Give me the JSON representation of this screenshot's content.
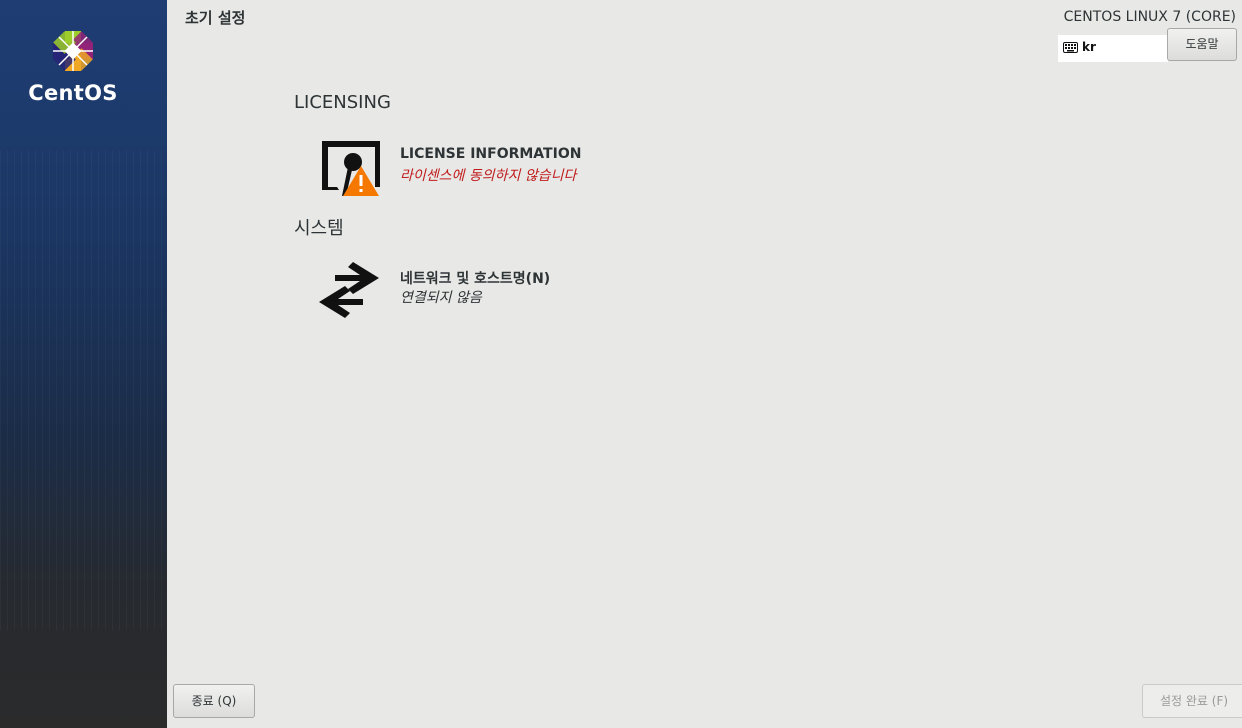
{
  "sidebar": {
    "logo_text": "CentOS"
  },
  "header": {
    "title": "초기 설정",
    "product": "CENTOS LINUX 7 (CORE)",
    "keyboard_layout": "kr",
    "help_label": "도움말"
  },
  "sections": [
    {
      "title": "LICENSING",
      "spokes": [
        {
          "title": "LICENSE INFORMATION",
          "status": "라이센스에 동의하지 않습니다",
          "icon": "license-warning-icon"
        }
      ]
    },
    {
      "title": "시스템",
      "spokes": [
        {
          "title": "네트워크 및 호스트명(N)",
          "status": "연결되지 않음",
          "icon": "network-arrows-icon"
        }
      ]
    }
  ],
  "footer": {
    "quit_label": "종료 (Q)",
    "finish_label": "설정 완료 (F)"
  },
  "colors": {
    "warning_text": "#c01c1c",
    "warning_icon": "#f57900",
    "sidebar_top": "#1f3d73",
    "sidebar_bottom": "#2b2b2b"
  }
}
